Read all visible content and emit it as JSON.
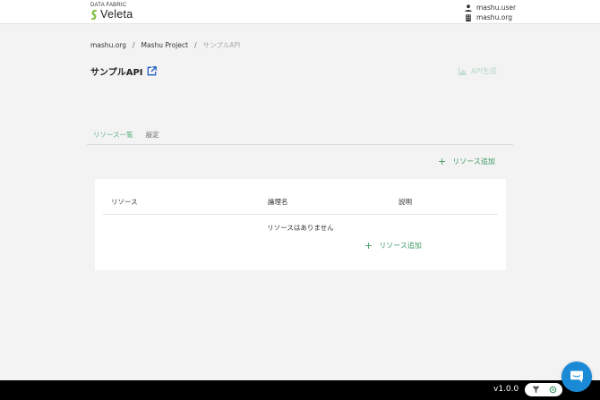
{
  "header": {
    "logo_top": "DATA FABRIC",
    "logo_name": "Veleta",
    "user_name": "mashu.user",
    "org_name": "mashu.org"
  },
  "breadcrumb": {
    "items": [
      "mashu.org",
      "Mashu Project",
      "サンプルAPI"
    ],
    "separator": "/"
  },
  "page": {
    "title": "サンプルAPI",
    "api_generate_label": "API生成"
  },
  "tabs": [
    {
      "label": "リソース一覧",
      "active": true
    },
    {
      "label": "設定",
      "active": false
    }
  ],
  "actions": {
    "add_resource_label": "リソース追加"
  },
  "table": {
    "columns": [
      "リソース",
      "論理名",
      "説明"
    ],
    "empty_message": "リソースはありません",
    "add_resource_label": "リソース追加"
  },
  "footer": {
    "version": "v1.0.0"
  },
  "colors": {
    "accent": "#3f9a63",
    "accent_light": "#5fb07f",
    "disabled": "#b8d8c4",
    "chat": "#1a8ad6",
    "link_icon": "#1f5fbf"
  },
  "icons": {
    "user": "user-icon",
    "org": "building-icon",
    "external": "external-link-icon",
    "chart": "bar-chart-icon",
    "plus": "plus-icon",
    "filter": "filter-icon",
    "refresh": "refresh-icon",
    "chat": "chat-icon"
  }
}
